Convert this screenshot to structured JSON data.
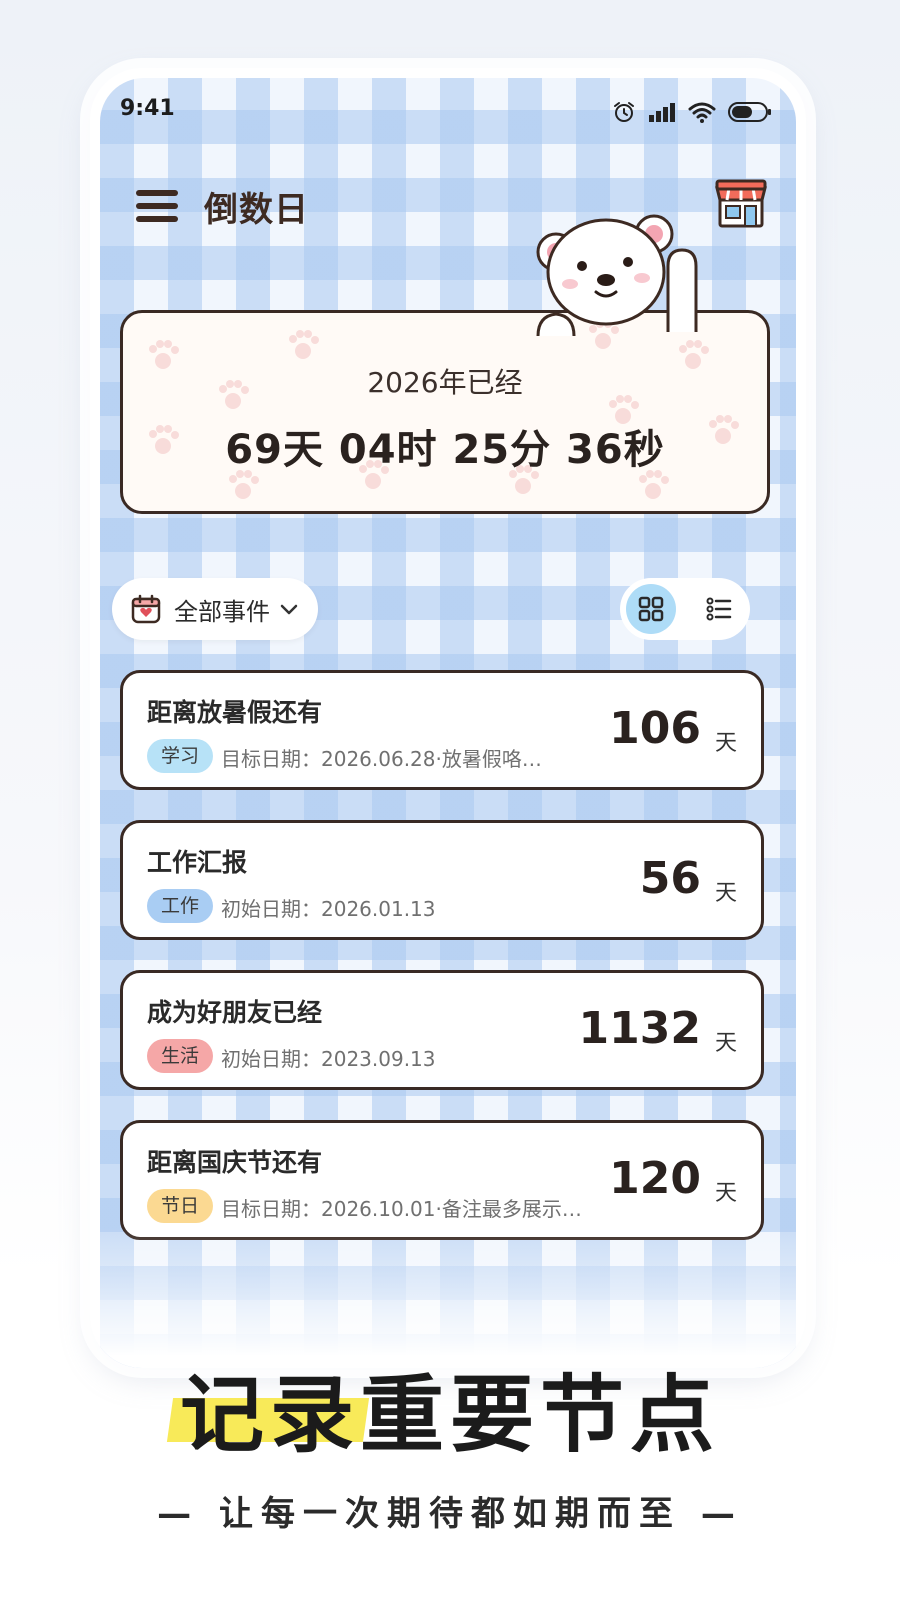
{
  "status_bar": {
    "time": "9:41"
  },
  "header": {
    "title": "倒数日"
  },
  "hero": {
    "label": "2026年已经",
    "value": "69天 04时 25分 36秒"
  },
  "filter": {
    "label": "全部事件"
  },
  "events": [
    {
      "title": "距离放暑假还有",
      "tag": "学习",
      "tag_color": "#b7e2f7",
      "meta": "目标日期：2026.06.28·放暑假咯…",
      "count": "106",
      "unit": "天"
    },
    {
      "title": "工作汇报",
      "tag": "工作",
      "tag_color": "#a9cdf3",
      "meta": "初始日期：2026.01.13",
      "count": "56",
      "unit": "天"
    },
    {
      "title": "成为好朋友已经",
      "tag": "生活",
      "tag_color": "#f5a7a7",
      "meta": "初始日期：2023.09.13",
      "count": "1132",
      "unit": "天"
    },
    {
      "title": "距离国庆节还有",
      "tag": "节日",
      "tag_color": "#fbd992",
      "meta": "目标日期：2026.10.01·备注最多展示…",
      "count": "120",
      "unit": "天"
    }
  ],
  "promo": {
    "tagline": "记录重要节点",
    "subtitle": "— 让每一次期待都如期而至 —",
    "highlight_color": "#f8ea59"
  }
}
